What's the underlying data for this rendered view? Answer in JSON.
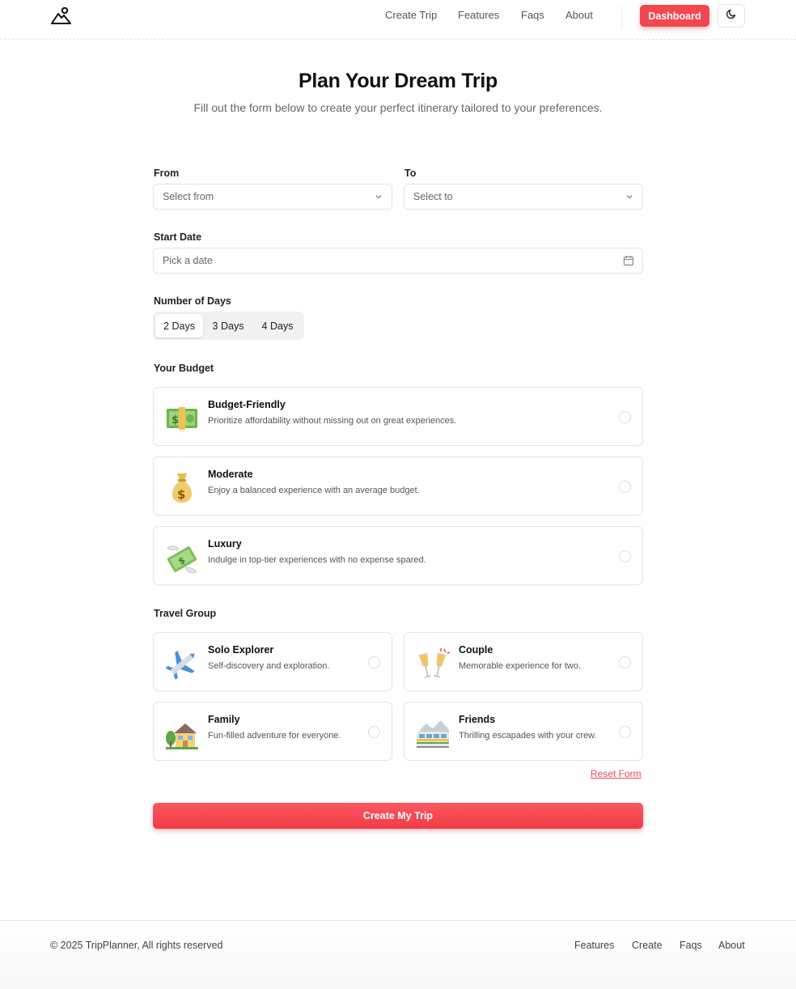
{
  "header": {
    "nav": [
      "Create Trip",
      "Features",
      "Faqs",
      "About"
    ],
    "dashboard_label": "Dashboard"
  },
  "page": {
    "title": "Plan Your Dream Trip",
    "subtitle": "Fill out the form below to create your perfect itinerary tailored to your preferences."
  },
  "form": {
    "from_label": "From",
    "from_placeholder": "Select from",
    "to_label": "To",
    "to_placeholder": "Select to",
    "start_date_label": "Start Date",
    "start_date_placeholder": "Pick a date",
    "days_label": "Number of Days",
    "days_options": [
      "2 Days",
      "3 Days",
      "4 Days"
    ],
    "days_selected": "2 Days",
    "budget_label": "Your Budget",
    "budget_options": [
      {
        "title": "Budget-Friendly",
        "desc": "Prioritize affordability without missing out on great experiences.",
        "icon": "dollar-banknote-icon"
      },
      {
        "title": "Moderate",
        "desc": "Enjoy a balanced experience with an average budget.",
        "icon": "money-bag-icon"
      },
      {
        "title": "Luxury",
        "desc": "Indulge in top-tier experiences with no expense spared.",
        "icon": "money-with-wings-icon"
      }
    ],
    "group_label": "Travel Group",
    "group_options": [
      {
        "title": "Solo Explorer",
        "desc": "Self-discovery and exploration.",
        "icon": "airplane-icon"
      },
      {
        "title": "Couple",
        "desc": "Memorable experience for two.",
        "icon": "clinking-glasses-icon"
      },
      {
        "title": "Family",
        "desc": "Fun-filled adventure for everyone.",
        "icon": "house-with-garden-icon"
      },
      {
        "title": "Friends",
        "desc": "Thrilling escapades with your crew.",
        "icon": "railway-car-icon"
      }
    ],
    "reset_label": "Reset Form",
    "submit_label": "Create My Trip"
  },
  "footer": {
    "copyright": "© 2025 TripPlanner, All rights reserved",
    "links": [
      "Features",
      "Create",
      "Faqs",
      "About"
    ]
  },
  "colors": {
    "accent": "#f4464f"
  }
}
